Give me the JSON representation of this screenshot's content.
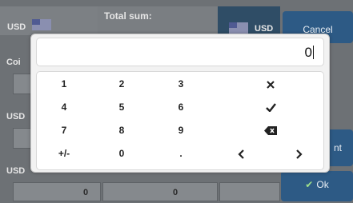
{
  "background": {
    "currency_left": "USD",
    "total_label": "Total sum:",
    "currency_right": "USD",
    "cancel_label": "Cancel",
    "coins_label": "Coi",
    "row_label_1": "USD",
    "row_label_2": "USD",
    "mid_button_partial": "nt",
    "ok_label": "Ok",
    "bottom_values": [
      "0",
      "0"
    ]
  },
  "keypad": {
    "display_value": "0",
    "keys": {
      "k1": "1",
      "k2": "2",
      "k3": "3",
      "k4": "4",
      "k5": "5",
      "k6": "6",
      "k7": "7",
      "k8": "8",
      "k9": "9",
      "plusminus": "+/-",
      "k0": "0",
      "dot": "."
    },
    "icons": {
      "close": "close-icon",
      "confirm": "check-icon",
      "backspace": "backspace-icon",
      "left": "chevron-left-icon",
      "right": "chevron-right-icon"
    }
  }
}
